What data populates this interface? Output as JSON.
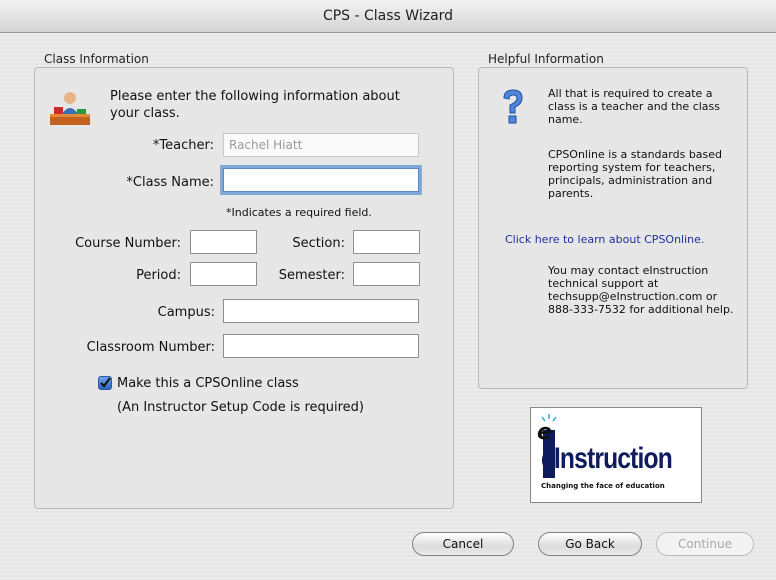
{
  "window": {
    "title": "CPS - Class Wizard"
  },
  "class_info": {
    "section_title": "Class Information",
    "intro": "Please enter the following information about your class.",
    "teacher_label": "*Teacher:",
    "teacher_value": "Rachel Hiatt",
    "class_name_label": "*Class Name:",
    "class_name_value": "",
    "required_note": "*Indicates a required field.",
    "course_number_label": "Course Number:",
    "course_number_value": "",
    "section_label": "Section:",
    "section_value": "",
    "period_label": "Period:",
    "period_value": "",
    "semester_label": "Semester:",
    "semester_value": "",
    "campus_label": "Campus:",
    "campus_value": "",
    "classroom_number_label": "Classroom Number:",
    "classroom_number_value": "",
    "cpsonline_checkbox_label": "Make this a CPSOnline class",
    "cpsonline_checked": true,
    "cpsonline_note": "(An Instructor Setup Code is required)"
  },
  "helpful_info": {
    "section_title": "Helpful Information",
    "required_text": "All that is required to create a class is a teacher and the class name.",
    "about_text": "CPSOnline is a standards based reporting system for teachers, principals, administration and parents.",
    "learn_link": "Click here to learn about CPSOnline.",
    "contact_text": "You may contact eInstruction technical support at techsupp@eInstruction.com or 888-333-7532 for additional help."
  },
  "logo": {
    "brand": "eInstruction",
    "tagline": "Changing the face of education"
  },
  "buttons": {
    "cancel": "Cancel",
    "go_back": "Go Back",
    "continue": "Continue"
  },
  "colors": {
    "link": "#1d2f9c",
    "focus_ring": "#7fa9d9",
    "checkbox_blue": "#2f67c5"
  }
}
